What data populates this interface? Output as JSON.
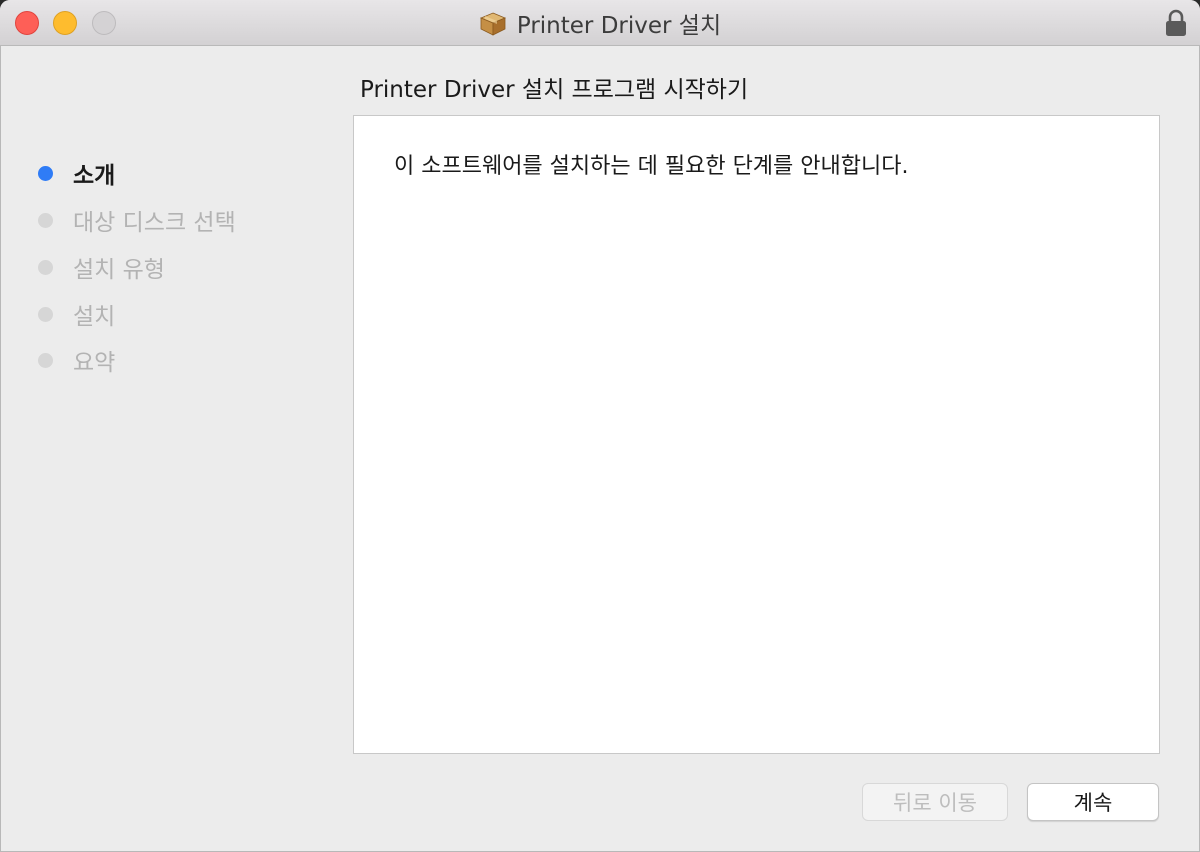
{
  "window": {
    "title": "Printer Driver 설치",
    "title_icon": "package-icon",
    "lock_icon": "lock-icon"
  },
  "sidebar": {
    "steps": [
      {
        "label": "소개",
        "active": true
      },
      {
        "label": "대상 디스크 선택",
        "active": false
      },
      {
        "label": "설치 유형",
        "active": false
      },
      {
        "label": "설치",
        "active": false
      },
      {
        "label": "요약",
        "active": false
      }
    ]
  },
  "main": {
    "heading": "Printer Driver 설치 프로그램 시작하기",
    "body": "이 소프트웨어를 설치하는 데 필요한 단계를 안내합니다."
  },
  "buttons": {
    "back_label": "뒤로 이동",
    "back_enabled": false,
    "continue_label": "계속"
  },
  "colors": {
    "active_step": "#2f7cf6",
    "inactive_step": "#d6d6d6",
    "close": "#fe5f57",
    "minimize": "#febc2e"
  }
}
